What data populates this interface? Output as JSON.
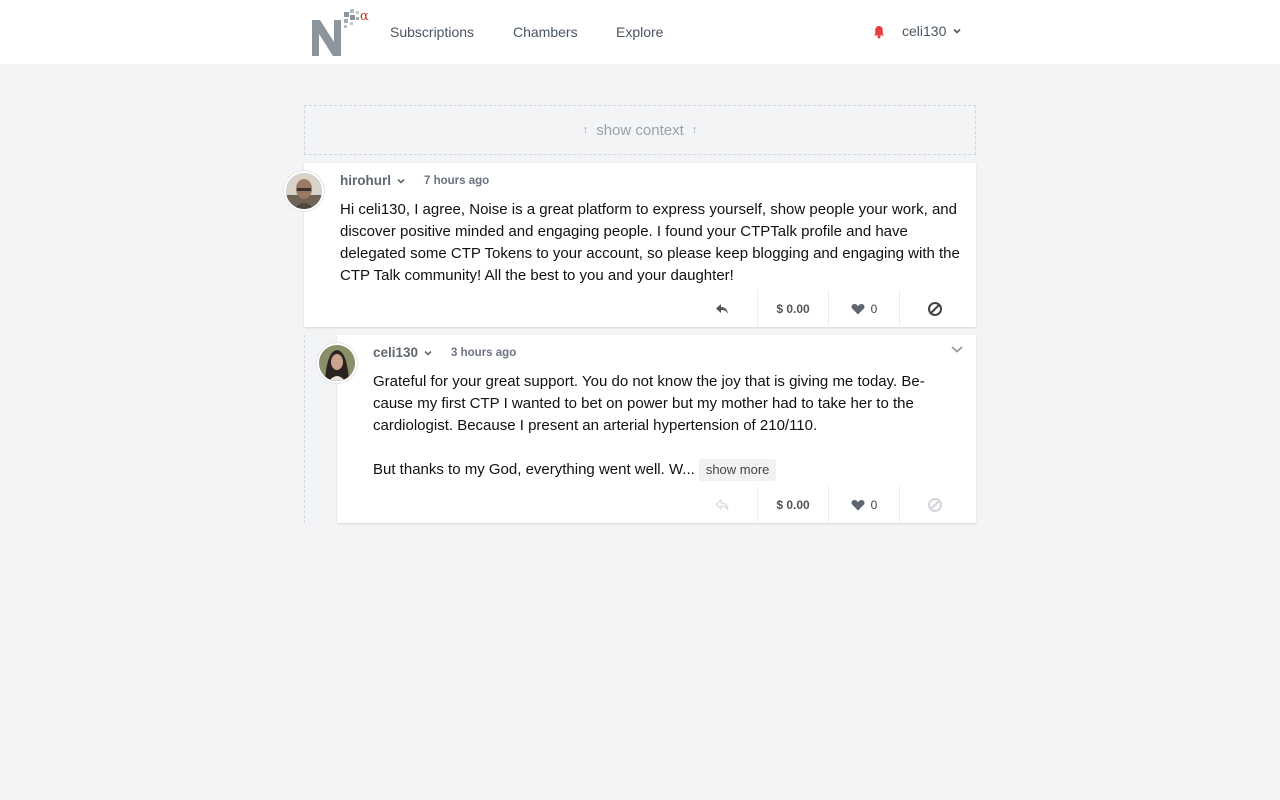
{
  "nav": {
    "links": [
      "Subscriptions",
      "Chambers",
      "Explore"
    ],
    "username": "celi130",
    "logo_superscript": "α"
  },
  "context": {
    "label": "show context"
  },
  "comments": [
    {
      "author": "hirohurl",
      "time": "7 hours ago",
      "body": [
        "Hi celi130, I agree, Noise is a great platform to express yourself, show people your work, and discover positive minded and engaging people. I found your CTPTalk profile and have delegated some CTP Tokens to your account, so please keep blogging and engaging with the CTP Talk community! All the best to you and your daughter!"
      ],
      "payout": "$ 0.00",
      "likes": "0"
    },
    {
      "author": "celi130",
      "time": "3 hours ago",
      "body": [
        "Grateful for your great support. You do not know the joy that is giving me today. Be­cause my first CTP I wanted to bet on power but my mother had to take her to the cardiologist. Because I present an arterial hypertension of 210/110.",
        "But thanks to my God, everything went well. W..."
      ],
      "show_more": "show more",
      "payout": "$ 0.00",
      "likes": "0"
    }
  ],
  "colors": {
    "bell": "#e53e3e",
    "logo_gray": "#8c959c",
    "logo_red": "#c0392b"
  }
}
